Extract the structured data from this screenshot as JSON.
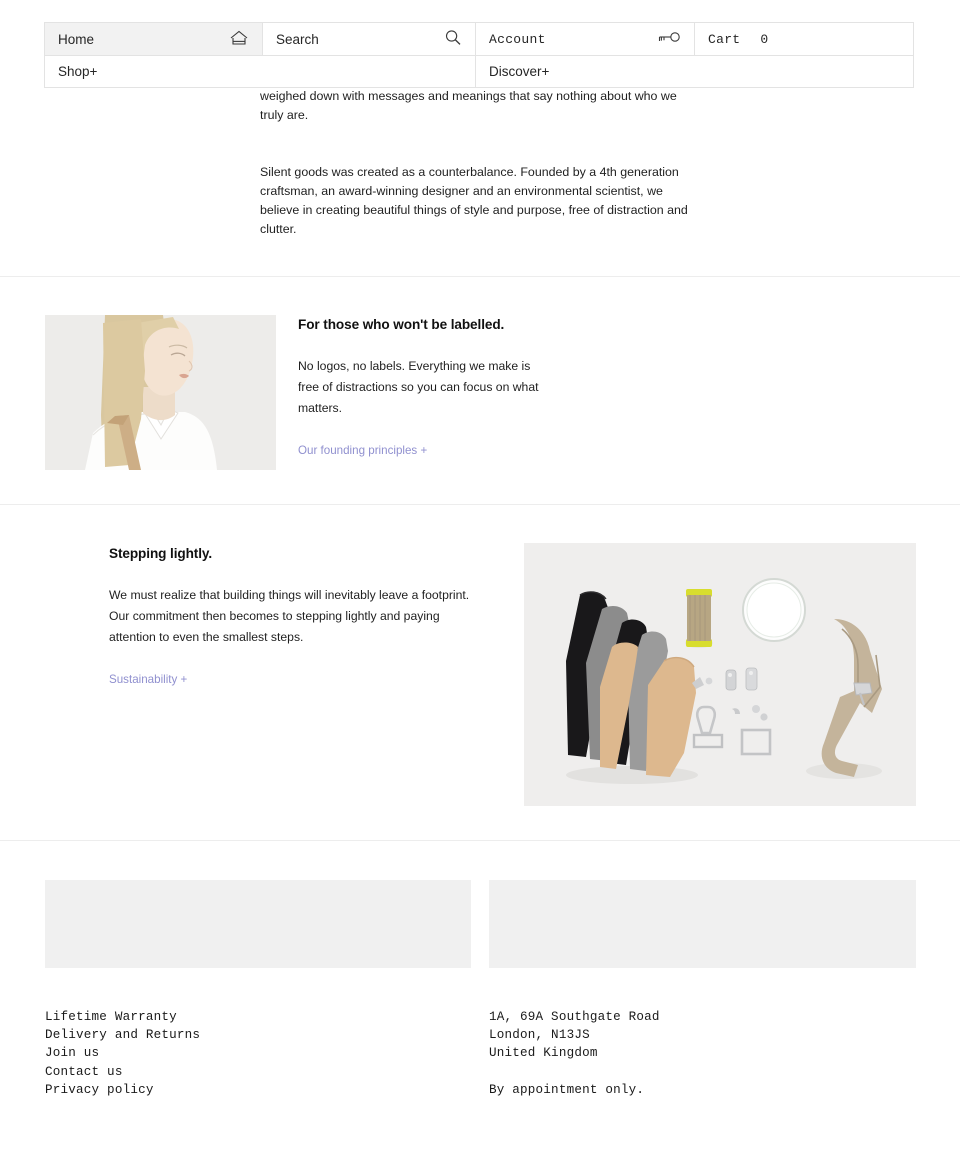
{
  "nav": {
    "home_label": "Home",
    "home_icon": "house-icon",
    "search_label": "Search",
    "search_icon": "search-icon",
    "account_label": "Account",
    "account_icon": "key-icon",
    "cart_label": "Cart",
    "cart_count": "0",
    "shop_label": "Shop+",
    "discover_label": "Discover+"
  },
  "intro": {
    "paragraph_1": "Our lives are full of noise. Practically everything we buy is pushing an agenda, weighed down with messages and meanings that say nothing about who we truly are.",
    "paragraph_2": "Silent goods was created as a counterbalance. Founded by a 4th generation craftsman, an award-winning designer and an environmental scientist, we believe in creating beautiful things of style and purpose, free of distraction and clutter."
  },
  "labelled": {
    "image_alt": "portrait of blonde woman in white shirt with tan strap",
    "heading": "For those who won't be labelled.",
    "body": "No logos, no labels. Everything we make is free of distractions so you can focus on what matters.",
    "link": "Our founding principles +"
  },
  "stepping": {
    "heading": "Stepping lightly.",
    "body": "We must realize that building things will inevitably leave a footprint. Our commitment then becomes to stepping lightly and paying attention to even the smallest steps.",
    "link": "Sustainability +",
    "image_alt": "flat lay of leather swatches, thread spool, glass disc, hardware and zipper"
  },
  "footer": {
    "links": [
      "Lifetime Warranty",
      "Delivery and Returns",
      "Join us",
      "Contact us",
      "Privacy policy"
    ],
    "address_line_1": "1A, 69A Southgate Road",
    "address_line_2": "London, N13JS",
    "address_line_3": "United Kingdom",
    "address_note": "By appointment only."
  },
  "colors": {
    "link_accent": "#9090cf",
    "panel_gray": "#f0f0f0",
    "border": "#e3e3e3",
    "divider": "#ededed"
  }
}
